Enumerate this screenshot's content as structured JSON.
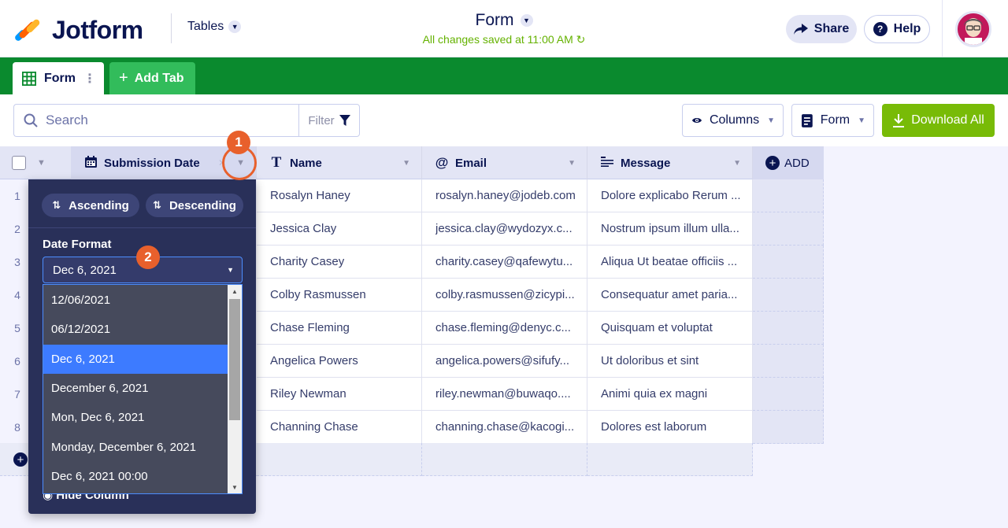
{
  "header": {
    "brand": "Jotform",
    "tables_label": "Tables",
    "title": "Form",
    "saved_status": "All changes saved at 11:00 AM",
    "share_label": "Share",
    "help_label": "Help"
  },
  "tabs": {
    "active_label": "Form",
    "add_label": "Add Tab"
  },
  "toolbar": {
    "search_placeholder": "Search",
    "filter_label": "Filter",
    "columns_label": "Columns",
    "view_label": "Form",
    "download_label": "Download All"
  },
  "table": {
    "columns": [
      {
        "label": "Submission Date",
        "icon": "calendar-icon"
      },
      {
        "label": "Name",
        "icon": "text-icon"
      },
      {
        "label": "Email",
        "icon": "at-icon"
      },
      {
        "label": "Message",
        "icon": "paragraph-icon"
      }
    ],
    "add_column_label": "ADD",
    "row_numbers": [
      "1",
      "2",
      "3",
      "4",
      "5",
      "6",
      "7",
      "8"
    ],
    "rows": [
      {
        "name": "Rosalyn Haney",
        "email": "rosalyn.haney@jodeb.com",
        "message": "Dolore explicabo Rerum ..."
      },
      {
        "name": "Jessica Clay",
        "email": "jessica.clay@wydozyx.c...",
        "message": "Nostrum ipsum illum ulla..."
      },
      {
        "name": "Charity Casey",
        "email": "charity.casey@qafewytu...",
        "message": "Aliqua Ut beatae officiis ..."
      },
      {
        "name": "Colby Rasmussen",
        "email": "colby.rasmussen@zicypi...",
        "message": "Consequatur amet paria..."
      },
      {
        "name": "Chase Fleming",
        "email": "chase.fleming@denyc.c...",
        "message": "Quisquam et voluptat"
      },
      {
        "name": "Angelica Powers",
        "email": "angelica.powers@sifufy...",
        "message": "Ut doloribus et sint"
      },
      {
        "name": "Riley Newman",
        "email": "riley.newman@buwaqo....",
        "message": "Animi quia ex magni"
      },
      {
        "name": "Channing Chase",
        "email": "channing.chase@kacogi...",
        "message": "Dolores est laborum"
      }
    ]
  },
  "column_menu": {
    "ascending_label": "Ascending",
    "descending_label": "Descending",
    "date_format_label": "Date Format",
    "selected_format": "Dec 6, 2021",
    "options": [
      "12/06/2021",
      "06/12/2021",
      "Dec 6, 2021",
      "December 6, 2021",
      "Mon, Dec 6, 2021",
      "Monday, December 6, 2021",
      "Dec 6, 2021 00:00"
    ],
    "selected_index": 2,
    "hide_column_label": "Hide Column"
  },
  "annotations": {
    "step1": "1",
    "step2": "2"
  },
  "colors": {
    "brand_navy": "#0a1551",
    "tab_bar_green": "#0a8a2e",
    "download_green": "#78bb07",
    "saved_green": "#64b200",
    "annotation_orange": "#e8602c",
    "selection_blue": "#3d7bff",
    "menu_bg": "#293059"
  }
}
